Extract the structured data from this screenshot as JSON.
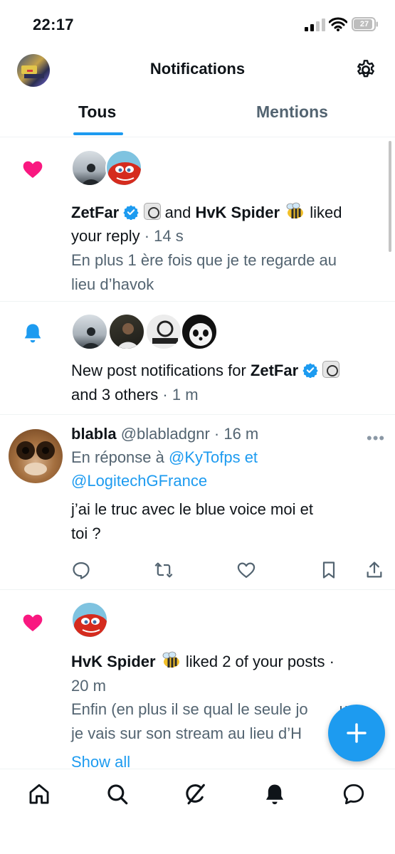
{
  "status_bar": {
    "time": "22:17",
    "battery": "27"
  },
  "header": {
    "title": "Notifications"
  },
  "tabs": [
    {
      "label": "Tous",
      "active": true
    },
    {
      "label": "Mentions",
      "active": false
    }
  ],
  "notifications": [
    {
      "type": "like",
      "user1": "ZetFar",
      "joiner": " and ",
      "user2": "HvK Spider",
      "action": " liked",
      "action2": "your reply",
      "time": " · 14 s",
      "preview_line1": "En plus 1 ère fois que je te regarde au",
      "preview_line2": "lieu d’havok"
    },
    {
      "type": "bell",
      "text_prefix": "New post notifications for ",
      "user": "ZetFar",
      "text_suffix": "and 3 others",
      "time": " · 1 m"
    },
    {
      "type": "reply",
      "name": "blabla",
      "handle": " @blabladgnr",
      "time": " · 16 m",
      "reply_prefix": "En réponse à ",
      "mention1": "@KyTofps",
      "mention_joiner": " et",
      "mention2": "@LogitechGFrance",
      "body_line1": "j’ai le truc avec le blue voice moi et",
      "body_line2": "toi ?"
    },
    {
      "type": "like",
      "user": "HvK Spider",
      "action": " liked 2 of your posts ·",
      "time": "20 m",
      "preview_line1": "Enfin (en plus il se qual le seule jo",
      "preview_line1_tail": "u",
      "preview_line2": "je vais sur son stream au lieu d’H",
      "show_all": "Show all"
    }
  ],
  "icons": {
    "like": "heart-icon",
    "bell": "bell-icon",
    "settings": "gear-icon",
    "nav": [
      "home-icon",
      "search-icon",
      "grok-icon",
      "notifications-icon",
      "messages-icon"
    ],
    "fab": "plus-icon"
  },
  "colors": {
    "accent": "#1d9bf0",
    "like": "#f91880",
    "text": "#0f1419",
    "muted": "#536471"
  }
}
